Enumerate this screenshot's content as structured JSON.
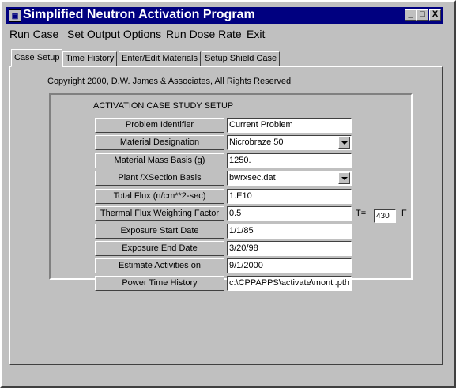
{
  "window": {
    "title": "Simplified Neutron Activation Program",
    "controls": {
      "minimize": "_",
      "maximize": "□",
      "close": "X"
    }
  },
  "menu": [
    "Run Case",
    "Set Output Options",
    "Run Dose Rate",
    "Exit"
  ],
  "tabs": [
    {
      "label": "Case Setup",
      "active": true
    },
    {
      "label": "Time History",
      "active": false
    },
    {
      "label": "Enter/Edit Materials",
      "active": false
    },
    {
      "label": "Setup Shield Case",
      "active": false
    }
  ],
  "copyright": "Copyright 2000, D.W. James & Associates, All Rights Reserved",
  "group_title": "ACTIVATION CASE STUDY SETUP",
  "rows": [
    {
      "label": "Problem Identifier",
      "value": "Current Problem",
      "dropdown": false
    },
    {
      "label": "Material Designation",
      "value": "Nicrobraze 50",
      "dropdown": true
    },
    {
      "label": "Material Mass Basis (g)",
      "value": "1250.",
      "dropdown": false
    },
    {
      "label": "Plant /XSection Basis",
      "value": "bwrxsec.dat",
      "dropdown": true
    },
    {
      "label": "Total Flux (n/cm**2-sec)",
      "value": "1.E10",
      "dropdown": false
    },
    {
      "label": "Thermal Flux Weighting Factor",
      "value": "0.5",
      "dropdown": false
    },
    {
      "label": "Exposure Start Date",
      "value": "1/1/85",
      "dropdown": false
    },
    {
      "label": "Exposure End Date",
      "value": "3/20/98",
      "dropdown": false
    },
    {
      "label": "Estimate Activities on",
      "value": "9/1/2000",
      "dropdown": false
    },
    {
      "label": "Power Time History",
      "value": "c:\\CPPAPPS\\activate\\monti.pth",
      "dropdown": false
    }
  ],
  "temperature": {
    "label": "T=",
    "value": "430",
    "unit": "F"
  },
  "colors": {
    "titlebar": "#000080",
    "face": "#c0c0c0",
    "field": "#ffffff"
  }
}
